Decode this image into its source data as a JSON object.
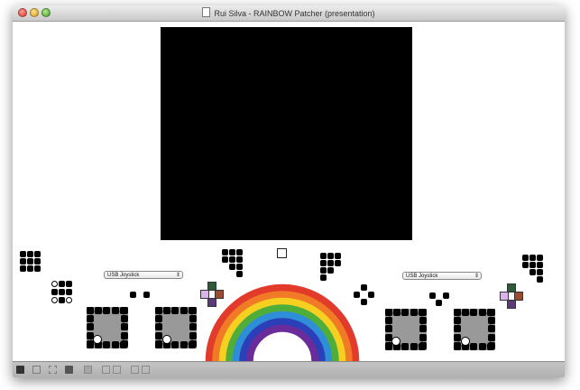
{
  "window": {
    "title": "Rui Silva - RAINBOW Patcher (presentation)"
  },
  "video_display": {
    "color": "#000000"
  },
  "joystick_menus": {
    "left": {
      "selected": "USB Joystick"
    },
    "right": {
      "selected": "USB Joystick"
    }
  },
  "rainbow": {
    "colors": [
      "#e23b2b",
      "#f07a25",
      "#f6d020",
      "#4fae3a",
      "#2f8ed8",
      "#2b3fb8",
      "#6a2c9a"
    ]
  },
  "dpad_colors": {
    "top": "#2f5a3a",
    "left": "#d9b3ea",
    "right": "#9b4b2e",
    "bottom": "#5b3a7a"
  },
  "statusbar": {
    "icons": [
      "lock-icon",
      "grid-icon",
      "fullscreen-icon",
      "inspector-icon",
      "info-icon",
      "copy-icon",
      "paste-icon",
      "window-icon",
      "panel-icon"
    ]
  }
}
